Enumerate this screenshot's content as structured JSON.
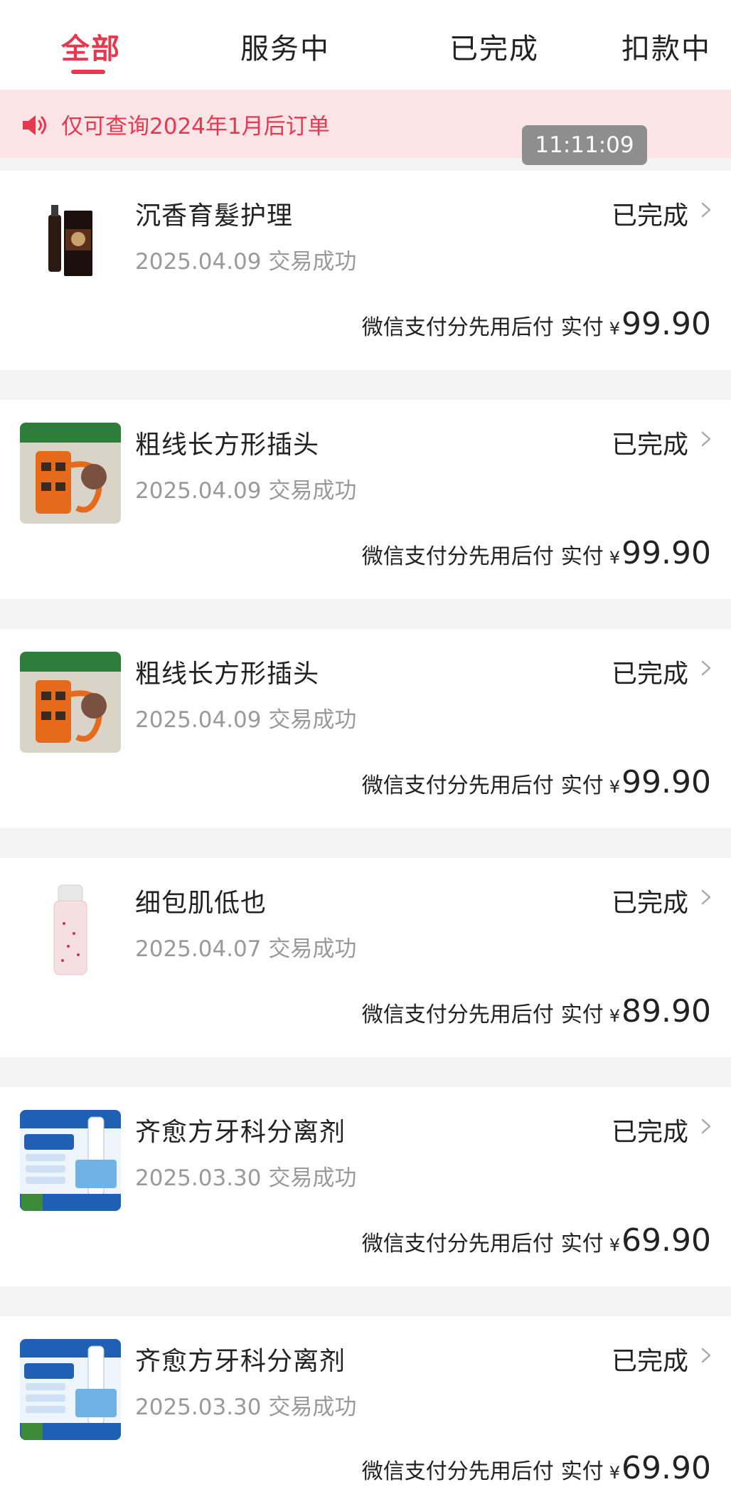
{
  "tabs": [
    {
      "label": "全部"
    },
    {
      "label": "服务中"
    },
    {
      "label": "已完成"
    },
    {
      "label": "扣款中"
    }
  ],
  "notice": {
    "icon": "speaker-icon",
    "text": "仅可查询2024年1月后订单"
  },
  "overlay_time": "11:11:09",
  "orders": [
    {
      "title": "沉香育髮护理",
      "date_status": "2025.04.09 交易成功",
      "status": "已完成",
      "payment_label": "微信支付分先用后付",
      "paid_label": "实付",
      "currency": "¥",
      "amount": "99.90"
    },
    {
      "title": "粗线长方形插头",
      "date_status": "2025.04.09 交易成功",
      "status": "已完成",
      "payment_label": "微信支付分先用后付",
      "paid_label": "实付",
      "currency": "¥",
      "amount": "99.90"
    },
    {
      "title": "粗线长方形插头",
      "date_status": "2025.04.09 交易成功",
      "status": "已完成",
      "payment_label": "微信支付分先用后付",
      "paid_label": "实付",
      "currency": "¥",
      "amount": "99.90"
    },
    {
      "title": "细包肌低也",
      "date_status": "2025.04.07 交易成功",
      "status": "已完成",
      "payment_label": "微信支付分先用后付",
      "paid_label": "实付",
      "currency": "¥",
      "amount": "89.90"
    },
    {
      "title": "齐愈方牙科分离剂",
      "date_status": "2025.03.30 交易成功",
      "status": "已完成",
      "payment_label": "微信支付分先用后付",
      "paid_label": "实付",
      "currency": "¥",
      "amount": "69.90"
    },
    {
      "title": "齐愈方牙科分离剂",
      "date_status": "2025.03.30 交易成功",
      "status": "已完成",
      "payment_label": "微信支付分先用后付",
      "paid_label": "实付",
      "currency": "¥",
      "amount": "69.90"
    }
  ],
  "colors": {
    "accent": "#e5394f",
    "notice_bg": "#fde4e6",
    "muted": "#9a9a9a"
  }
}
